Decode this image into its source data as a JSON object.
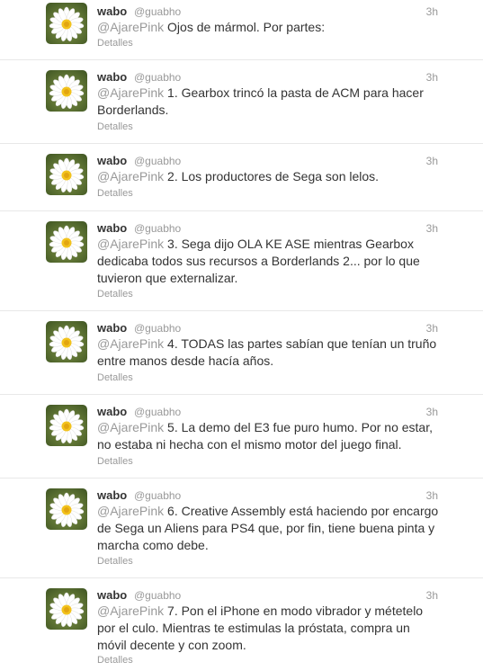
{
  "tweets": [
    {
      "name": "wabo",
      "handle": "@guabho",
      "time": "3h",
      "mention": "@AjarePink",
      "text": " Ojos de mármol. Por partes:",
      "details": "Detalles"
    },
    {
      "name": "wabo",
      "handle": "@guabho",
      "time": "3h",
      "mention": "@AjarePink",
      "text": " 1. Gearbox trincó la pasta de ACM para hacer Borderlands.",
      "details": "Detalles"
    },
    {
      "name": "wabo",
      "handle": "@guabho",
      "time": "3h",
      "mention": "@AjarePink",
      "text": " 2. Los productores de Sega son lelos.",
      "details": "Detalles"
    },
    {
      "name": "wabo",
      "handle": "@guabho",
      "time": "3h",
      "mention": "@AjarePink",
      "text": " 3. Sega dijo OLA KE ASE mientras Gearbox dedicaba todos sus recursos a Borderlands 2... por lo que tuvieron que externalizar.",
      "details": "Detalles"
    },
    {
      "name": "wabo",
      "handle": "@guabho",
      "time": "3h",
      "mention": "@AjarePink",
      "text": " 4. TODAS las partes sabían que tenían un truño entre manos desde hacía años.",
      "details": "Detalles"
    },
    {
      "name": "wabo",
      "handle": "@guabho",
      "time": "3h",
      "mention": "@AjarePink",
      "text": " 5. La demo del E3 fue puro humo. Por no estar, no estaba ni hecha con el mismo motor del juego final.",
      "details": "Detalles"
    },
    {
      "name": "wabo",
      "handle": "@guabho",
      "time": "3h",
      "mention": "@AjarePink",
      "text": " 6. Creative Assembly está haciendo por encargo de Sega un Aliens para PS4 que, por fin, tiene buena pinta y marcha como debe.",
      "details": "Detalles"
    },
    {
      "name": "wabo",
      "handle": "@guabho",
      "time": "3h",
      "mention": "@AjarePink",
      "text": " 7. Pon el iPhone en modo vibrador y métetelo por el culo. Mientras te estimulas la próstata, compra un móvil decente y con zoom.",
      "details": "Detalles"
    }
  ],
  "avatar_icon": "daisy-flower"
}
